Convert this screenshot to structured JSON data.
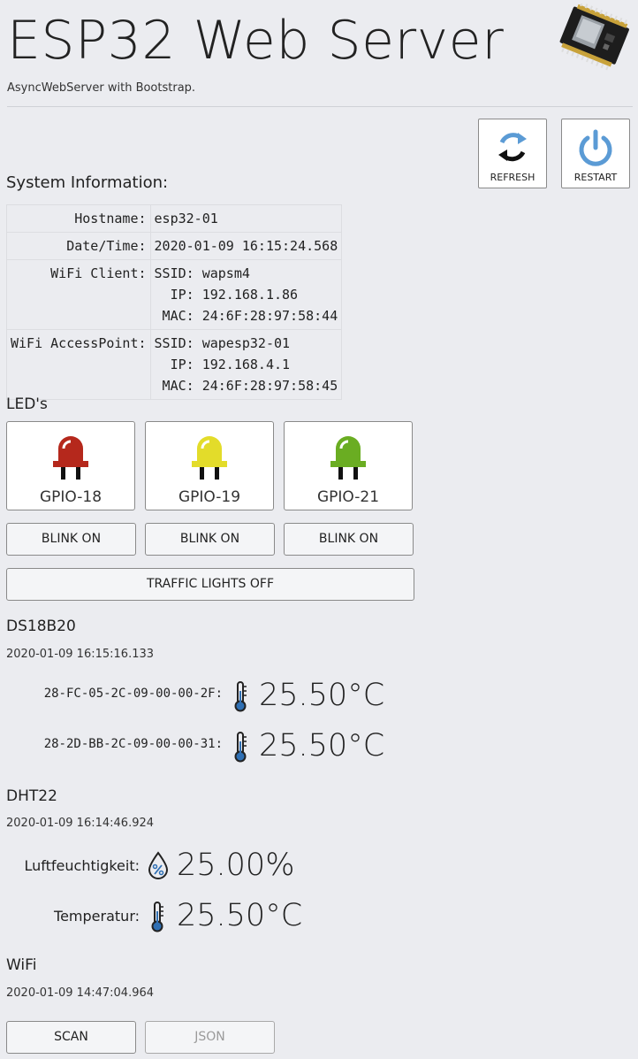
{
  "header": {
    "title": "ESP32 Web Server",
    "subtitle": "AsyncWebServer with Bootstrap."
  },
  "toolbar": {
    "refresh_label": "REFRESH",
    "restart_label": "RESTART"
  },
  "system": {
    "heading": "System Information:",
    "rows": [
      {
        "key": "Hostname:",
        "value": "esp32-01"
      },
      {
        "key": "Date/Time:",
        "value": "2020-01-09 16:15:24.568"
      },
      {
        "key": "WiFi Client:",
        "value": "SSID: wapsm4\n  IP: 192.168.1.86\n MAC: 24:6F:28:97:58:44"
      },
      {
        "key": "WiFi AccessPoint:",
        "value": "SSID: wapesp32-01\n  IP: 192.168.4.1\n MAC: 24:6F:28:97:58:45"
      }
    ]
  },
  "leds": {
    "heading": "LED's",
    "items": [
      {
        "label": "GPIO-18",
        "color": "#b5281c",
        "blink_label": "BLINK ON"
      },
      {
        "label": "GPIO-19",
        "color": "#e3dc2a",
        "blink_label": "BLINK ON"
      },
      {
        "label": "GPIO-21",
        "color": "#6aad22",
        "blink_label": "BLINK ON"
      }
    ],
    "traffic_label": "TRAFFIC LIGHTS OFF"
  },
  "ds18b20": {
    "heading": "DS18B20",
    "timestamp": "2020-01-09 16:15:16.133",
    "sensors": [
      {
        "id": "28-FC-05-2C-09-00-00-2F:",
        "icon": "thermometer-icon",
        "value": "25.50°C"
      },
      {
        "id": "28-2D-BB-2C-09-00-00-31:",
        "icon": "thermometer-icon",
        "value": "25.50°C"
      }
    ]
  },
  "dht22": {
    "heading": "DHT22",
    "timestamp": "2020-01-09 16:14:46.924",
    "humidity_label": "Luftfeuchtigkeit:",
    "humidity_icon": "humidity-drop-icon",
    "humidity_value": "25.00%",
    "temp_label": "Temperatur:",
    "temp_icon": "thermometer-icon",
    "temp_value": "25.50°C"
  },
  "wifi": {
    "heading": "WiFi",
    "timestamp": "2020-01-09 14:47:04.964",
    "scan_label": "SCAN",
    "json_label": "JSON"
  },
  "colors": {
    "background": "#ebecf0",
    "icon_blue": "#5b9bd5"
  }
}
